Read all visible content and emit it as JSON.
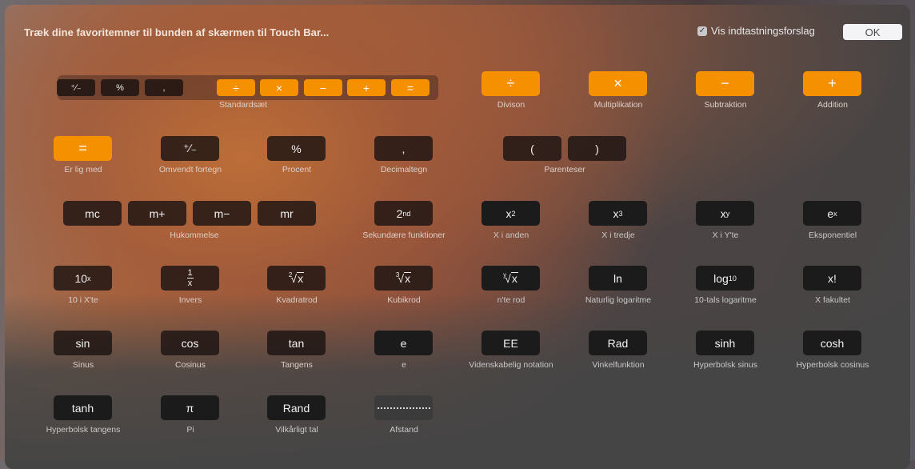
{
  "header": {
    "instructions": "Træk dine favoritemner til bunden af skærmen til Touch Bar...",
    "suggestions_checkbox": {
      "label": "Vis indtastningsforslag",
      "checked": true
    },
    "ok_label": "OK"
  },
  "colors": {
    "accent_orange": "#f59000",
    "key_dark": "#1c1b1b",
    "panel_gray": "#454545"
  },
  "standard_set": {
    "label": "Standardsæt",
    "keys": [
      "⁺∕₋",
      "%",
      ",",
      "÷",
      "×",
      "−",
      "+",
      "="
    ]
  },
  "operators": [
    {
      "key": "÷",
      "label": "Divison"
    },
    {
      "key": "×",
      "label": "Multiplikation"
    },
    {
      "key": "−",
      "label": "Subtraktion"
    },
    {
      "key": "+",
      "label": "Addition"
    }
  ],
  "row2": [
    {
      "key": "=",
      "label": "Er lig med"
    },
    {
      "key": "⁺∕₋",
      "label": "Omvendt fortegn"
    },
    {
      "key": "%",
      "label": "Procent"
    },
    {
      "key": ",",
      "label": "Decimaltegn"
    }
  ],
  "parentheses": {
    "open": "(",
    "close": ")",
    "label": "Parenteser"
  },
  "memory": {
    "keys": [
      "mc",
      "m+",
      "m−",
      "mr"
    ],
    "label": "Hukommelse"
  },
  "second": {
    "base": "2",
    "sup": "nd",
    "label": "Sekundære funktioner"
  },
  "powers": [
    {
      "base": "x",
      "sup": "2",
      "label": "X i anden"
    },
    {
      "base": "x",
      "sup": "3",
      "label": "X i tredje"
    },
    {
      "base": "x",
      "sup": "y",
      "label": "X i Y'te"
    },
    {
      "base": "e",
      "sup": "x",
      "label": "Eksponentiel"
    }
  ],
  "row4": {
    "ten_x": {
      "base": "10",
      "sup": "x",
      "label": "10 i X'te"
    },
    "inverse": {
      "num": "1",
      "den": "x",
      "label": "Invers"
    },
    "sqrt": {
      "idx": "2",
      "rad": "x",
      "label": "Kvadratrod"
    },
    "cbrt": {
      "idx": "3",
      "rad": "x",
      "label": "Kubikrod"
    },
    "nroot": {
      "idx": "y",
      "rad": "x",
      "label": "n'te rod"
    },
    "ln": {
      "key": "ln",
      "label": "Naturlig logaritme"
    },
    "log10": {
      "base": "log",
      "sub": "10",
      "label": "10-tals logaritme"
    },
    "fact": {
      "key": "x!",
      "label": "X fakultet"
    }
  },
  "row5": [
    {
      "key": "sin",
      "label": "Sinus"
    },
    {
      "key": "cos",
      "label": "Cosinus"
    },
    {
      "key": "tan",
      "label": "Tangens"
    },
    {
      "key": "e",
      "label": "e"
    },
    {
      "key": "EE",
      "label": "Videnskabelig notation"
    },
    {
      "key": "Rad",
      "label": "Vinkelfunktion"
    },
    {
      "key": "sinh",
      "label": "Hyperbolsk sinus"
    },
    {
      "key": "cosh",
      "label": "Hyperbolsk cosinus"
    }
  ],
  "row6": [
    {
      "key": "tanh",
      "label": "Hyperbolsk tangens"
    },
    {
      "key": "π",
      "label": "Pi"
    },
    {
      "key": "Rand",
      "label": "Vilkårligt tal"
    },
    {
      "key": "",
      "label": "Afstand"
    }
  ]
}
